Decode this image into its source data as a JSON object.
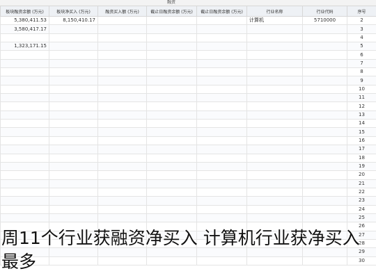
{
  "app": {
    "topbar_label": "融资"
  },
  "table": {
    "headers": [
      "板块融资余额 (万元)",
      "板块净买入 (万元)",
      "融资买入额 (万元)",
      "截止日融资余额 (万元)",
      "截止日融资余额 (万元)",
      "行业名称",
      "行业代码",
      "序号"
    ],
    "rows": [
      {
        "c1": "5,380,411.53",
        "c2": "8,150,410.17",
        "c3": "",
        "c4": "",
        "c5": "",
        "name": "计算机",
        "code": "5710000",
        "idx": "2"
      },
      {
        "c1": "3,580,417.17",
        "c2": "",
        "c3": "",
        "c4": "",
        "c5": "",
        "name": "",
        "code": "",
        "idx": "3"
      },
      {
        "c1": "",
        "c2": "",
        "c3": "",
        "c4": "",
        "c5": "",
        "name": "",
        "code": "",
        "idx": "4"
      },
      {
        "c1": "1,323,171.15",
        "c2": "",
        "c3": "",
        "c4": "",
        "c5": "",
        "name": "",
        "code": "",
        "idx": "5"
      },
      {
        "c1": "",
        "c2": "",
        "c3": "",
        "c4": "",
        "c5": "",
        "name": "",
        "code": "",
        "idx": "6"
      },
      {
        "c1": "",
        "c2": "",
        "c3": "",
        "c4": "",
        "c5": "",
        "name": "",
        "code": "",
        "idx": "7"
      },
      {
        "c1": "",
        "c2": "",
        "c3": "",
        "c4": "",
        "c5": "",
        "name": "",
        "code": "",
        "idx": "8"
      },
      {
        "c1": "",
        "c2": "",
        "c3": "",
        "c4": "",
        "c5": "",
        "name": "",
        "code": "",
        "idx": "9"
      },
      {
        "c1": "",
        "c2": "",
        "c3": "",
        "c4": "",
        "c5": "",
        "name": "",
        "code": "",
        "idx": "10"
      },
      {
        "c1": "",
        "c2": "",
        "c3": "",
        "c4": "",
        "c5": "",
        "name": "",
        "code": "",
        "idx": "11"
      },
      {
        "c1": "",
        "c2": "",
        "c3": "",
        "c4": "",
        "c5": "",
        "name": "",
        "code": "",
        "idx": "12"
      },
      {
        "c1": "",
        "c2": "",
        "c3": "",
        "c4": "",
        "c5": "",
        "name": "",
        "code": "",
        "idx": "13"
      },
      {
        "c1": "",
        "c2": "",
        "c3": "",
        "c4": "",
        "c5": "",
        "name": "",
        "code": "",
        "idx": "14"
      },
      {
        "c1": "",
        "c2": "",
        "c3": "",
        "c4": "",
        "c5": "",
        "name": "",
        "code": "",
        "idx": "15"
      },
      {
        "c1": "",
        "c2": "",
        "c3": "",
        "c4": "",
        "c5": "",
        "name": "",
        "code": "",
        "idx": "16"
      },
      {
        "c1": "",
        "c2": "",
        "c3": "",
        "c4": "",
        "c5": "",
        "name": "",
        "code": "",
        "idx": "17"
      },
      {
        "c1": "",
        "c2": "",
        "c3": "",
        "c4": "",
        "c5": "",
        "name": "",
        "code": "",
        "idx": "18"
      },
      {
        "c1": "",
        "c2": "",
        "c3": "",
        "c4": "",
        "c5": "",
        "name": "",
        "code": "",
        "idx": "19"
      },
      {
        "c1": "",
        "c2": "",
        "c3": "",
        "c4": "",
        "c5": "",
        "name": "",
        "code": "",
        "idx": "20"
      },
      {
        "c1": "",
        "c2": "",
        "c3": "",
        "c4": "",
        "c5": "",
        "name": "",
        "code": "",
        "idx": "21"
      },
      {
        "c1": "",
        "c2": "",
        "c3": "",
        "c4": "",
        "c5": "",
        "name": "",
        "code": "",
        "idx": "22"
      },
      {
        "c1": "",
        "c2": "",
        "c3": "",
        "c4": "",
        "c5": "",
        "name": "",
        "code": "",
        "idx": "23"
      },
      {
        "c1": "",
        "c2": "",
        "c3": "",
        "c4": "",
        "c5": "",
        "name": "",
        "code": "",
        "idx": "24"
      },
      {
        "c1": "",
        "c2": "",
        "c3": "",
        "c4": "",
        "c5": "",
        "name": "",
        "code": "",
        "idx": "25"
      },
      {
        "c1": "",
        "c2": "",
        "c3": "",
        "c4": "",
        "c5": "",
        "name": "",
        "code": "",
        "idx": "26"
      },
      {
        "c1": "",
        "c2": "",
        "c3": "",
        "c4": "",
        "c5": "",
        "name": "",
        "code": "",
        "idx": "27"
      },
      {
        "c1": "",
        "c2": "",
        "c3": "",
        "c4": "",
        "c5": "",
        "name": "",
        "code": "",
        "idx": "28"
      },
      {
        "c1": "",
        "c2": "",
        "c3": "",
        "c4": "",
        "c5": "",
        "name": "",
        "code": "",
        "idx": "29"
      },
      {
        "c1": "",
        "c2": "",
        "c3": "",
        "c4": "",
        "c5": "",
        "name": "",
        "code": "",
        "idx": "30"
      }
    ]
  },
  "caption": {
    "text": "周11个行业获融资净买入 计算机行业获净买入最多"
  }
}
